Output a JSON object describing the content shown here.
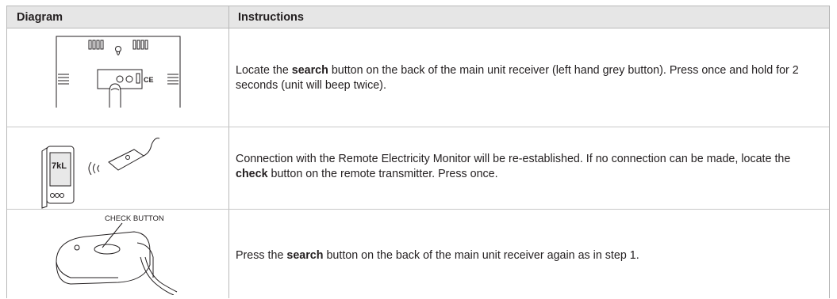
{
  "table": {
    "headers": {
      "diagram": "Diagram",
      "instructions": "Instructions"
    },
    "rows": [
      {
        "before": "Locate the ",
        "bold": "search",
        "after": " button on the back of the main unit receiver (left hand grey button). Press once and hold for 2 seconds (unit will beep twice)."
      },
      {
        "before": "Connection with the Remote Electricity Monitor will be re-established.   If no connection can be made, locate the ",
        "bold": "check",
        "after": " button on the remote transmitter. Press once."
      },
      {
        "before": "Press the ",
        "bold": "search",
        "after": " button on the back of the main unit receiver again as in step 1."
      }
    ],
    "diagram_labels": {
      "ce_mark": "CE",
      "display_digits": "7kL",
      "check_button_label": "CHECK BUTTON"
    }
  }
}
